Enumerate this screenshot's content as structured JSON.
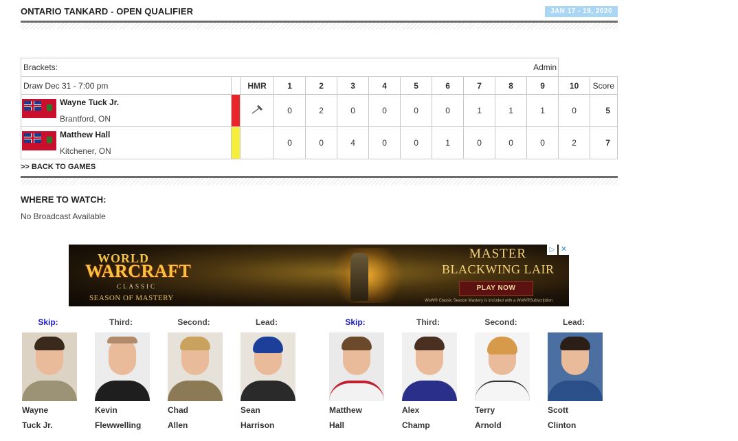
{
  "event": {
    "title": "ONTARIO TANKARD - OPEN QUALIFIER",
    "dates": "JAN 17 - 19, 2020"
  },
  "scoreboard": {
    "brackets_label": "Brackets:",
    "admin_label": "Admin",
    "draw_label": "Draw Dec 31 - 7:00 pm",
    "hammer_label": "HMR",
    "ends": [
      "1",
      "2",
      "3",
      "4",
      "5",
      "6",
      "7",
      "8",
      "9",
      "10"
    ],
    "score_label": "Score",
    "teams": [
      {
        "name": "Wayne Tuck Jr.",
        "location": "Brantford, ON",
        "stone_color": "#e8252b",
        "hammer": true,
        "ends": [
          "0",
          "2",
          "0",
          "0",
          "0",
          "0",
          "1",
          "1",
          "1",
          "0"
        ],
        "total": "5"
      },
      {
        "name": "Matthew Hall",
        "location": "Kitchener, ON",
        "stone_color": "#f6ee3a",
        "hammer": false,
        "ends": [
          "0",
          "0",
          "4",
          "0",
          "0",
          "1",
          "0",
          "0",
          "0",
          "2"
        ],
        "total": "7"
      }
    ]
  },
  "back_link": ">> BACK TO GAMES",
  "watch": {
    "title": "WHERE TO WATCH:",
    "text": "No Broadcast Available"
  },
  "ad": {
    "logo_top": "WORLD",
    "logo_main": "WARCRAFT",
    "logo_sub": "CLASSIC",
    "season": "SEASON OF MASTERY",
    "headline_1": "MASTER",
    "headline_2": "BLACKWING LAIR",
    "cta": "PLAY NOW",
    "legal": "WoW® Classic Season Mastery is included with a WoW®Subscription"
  },
  "lineups": [
    {
      "position": "Skip:",
      "first": "Wayne",
      "last": "Tuck Jr."
    },
    {
      "position": "Third:",
      "first": "Kevin",
      "last": "Flewwelling"
    },
    {
      "position": "Second:",
      "first": "Chad",
      "last": "Allen"
    },
    {
      "position": "Lead:",
      "first": "Sean",
      "last": "Harrison"
    },
    {
      "position": "Skip:",
      "first": "Matthew",
      "last": "Hall"
    },
    {
      "position": "Third:",
      "first": "Alex",
      "last": "Champ"
    },
    {
      "position": "Second:",
      "first": "Terry",
      "last": "Arnold"
    },
    {
      "position": "Lead:",
      "first": "Scott",
      "last": "Clinton"
    }
  ],
  "colors": {
    "skip_label": "#1a1acc",
    "date_badge": "#a9d6f5",
    "red_stone": "#e8252b",
    "yellow_stone": "#f6ee3a"
  }
}
